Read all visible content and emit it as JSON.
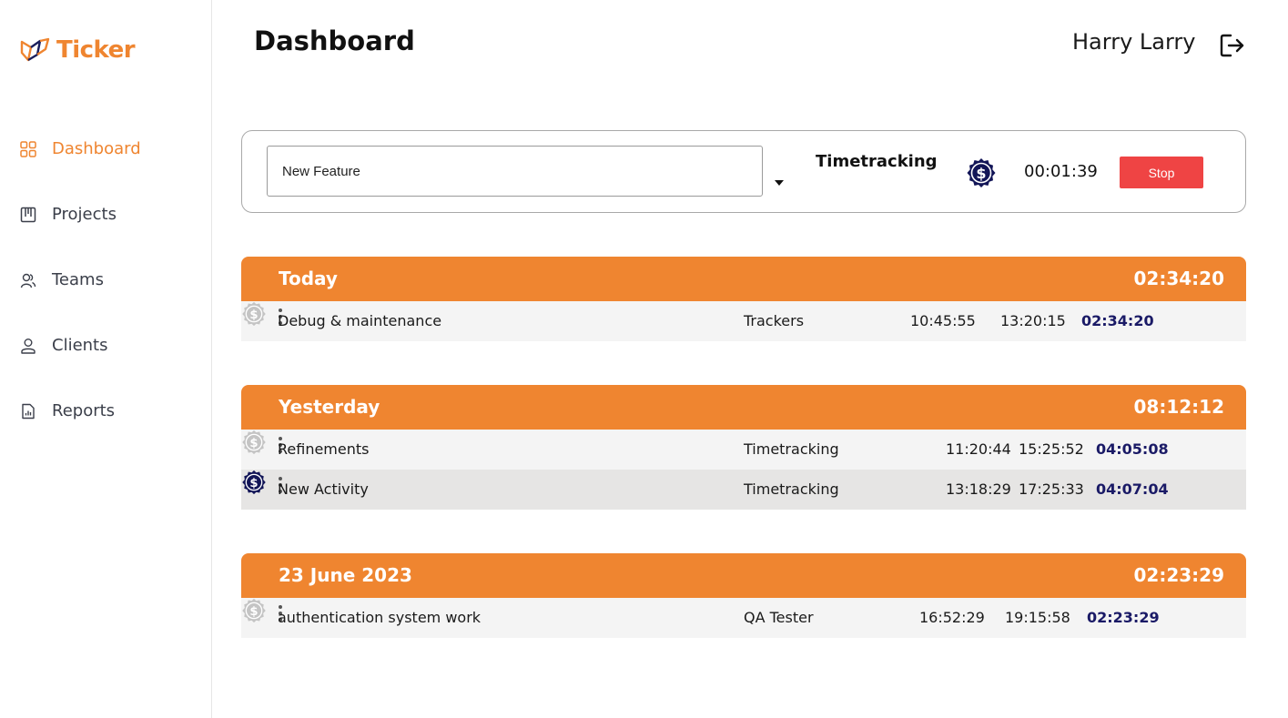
{
  "app": {
    "name": "Ticker",
    "accent": "#ef8530"
  },
  "sidebar": {
    "items": [
      {
        "label": "Dashboard",
        "icon": "grid-icon",
        "active": true
      },
      {
        "label": "Projects",
        "icon": "kanban-icon",
        "active": false
      },
      {
        "label": "Teams",
        "icon": "team-icon",
        "active": false
      },
      {
        "label": "Clients",
        "icon": "user-icon",
        "active": false
      },
      {
        "label": "Reports",
        "icon": "report-icon",
        "active": false
      }
    ]
  },
  "header": {
    "title": "Dashboard",
    "user": "Harry Larry",
    "logout_icon": "logout-icon"
  },
  "tracker": {
    "task_value": "New Feature",
    "project": "Timetracking",
    "billable": true,
    "elapsed": "00:01:39",
    "stop_label": "Stop",
    "stop_color": "#ef4444"
  },
  "groups": [
    {
      "title": "Today",
      "total": "02:34:20",
      "rows": [
        {
          "description": "Debug & maintenance",
          "project": "Trackers",
          "billable": false,
          "start": "10:45:55",
          "end": "13:20:15",
          "duration": "02:34:20"
        }
      ]
    },
    {
      "title": "Yesterday",
      "total": "08:12:12",
      "rows": [
        {
          "description": "Refinements",
          "project": "Timetracking",
          "billable": false,
          "start": "11:20:44",
          "end": "15:25:52",
          "duration": "04:05:08"
        },
        {
          "description": "New Activity",
          "project": "Timetracking",
          "billable": true,
          "start": "13:18:29",
          "end": "17:25:33",
          "duration": "04:07:04"
        }
      ]
    },
    {
      "title": "23 June 2023",
      "total": "02:23:29",
      "rows": [
        {
          "description": "authentication system work",
          "project": "QA Tester",
          "billable": false,
          "start": "16:52:29",
          "end": "19:15:58",
          "duration": "02:23:29"
        }
      ]
    }
  ]
}
